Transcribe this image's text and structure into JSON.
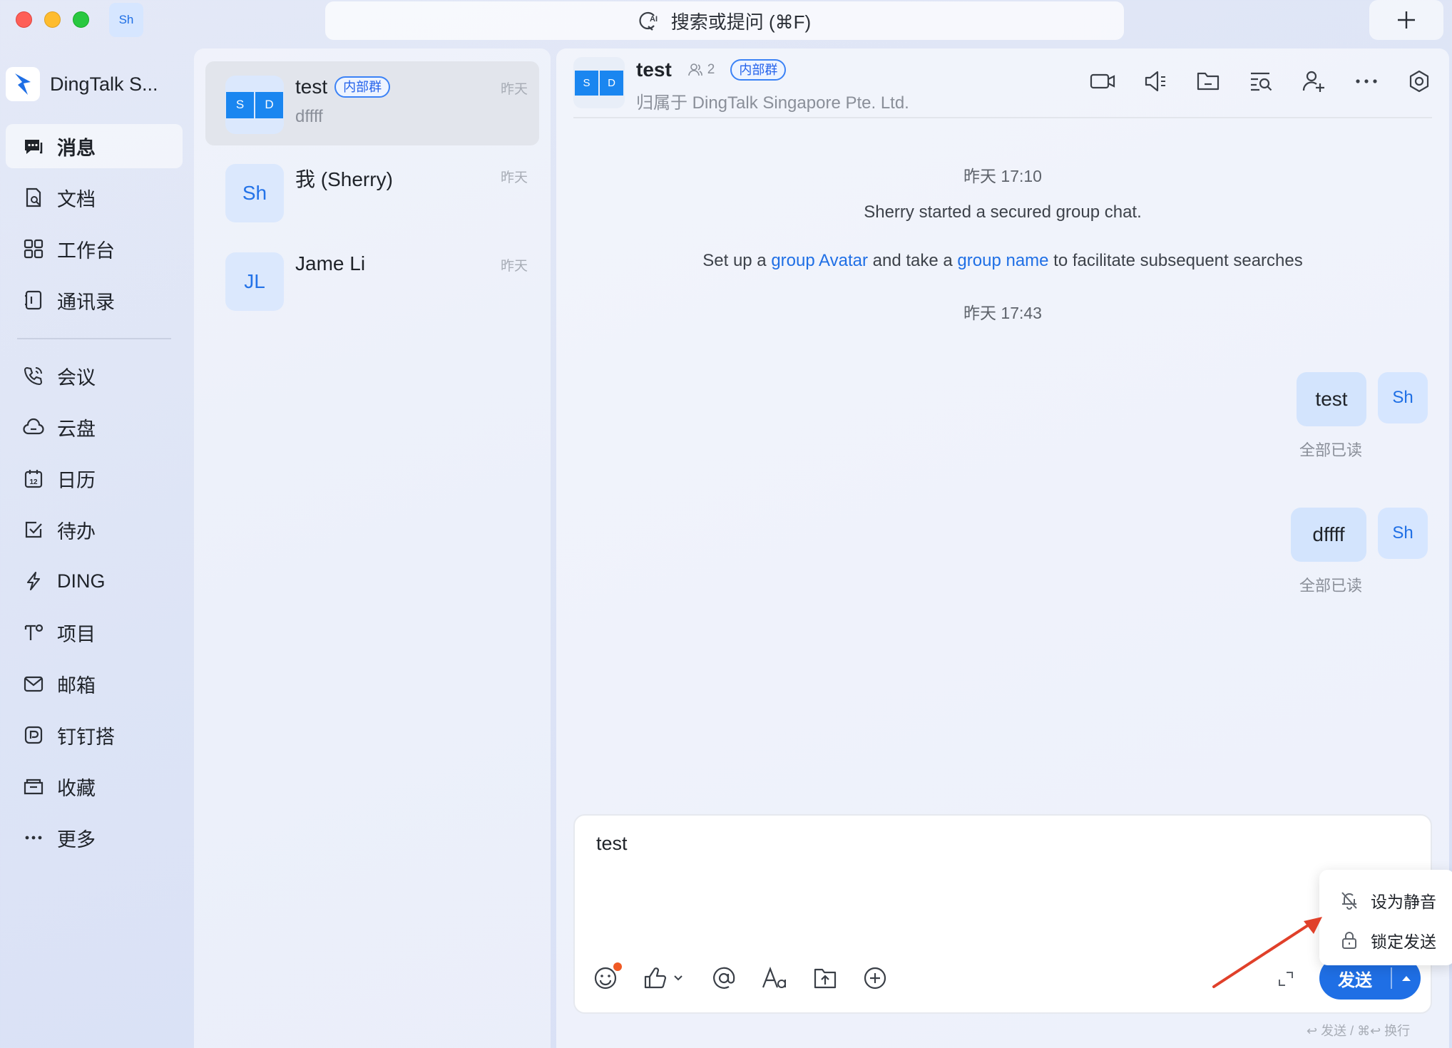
{
  "titlebar": {
    "avatar": "Sh",
    "search_placeholder": "搜索或提问 (⌘F)"
  },
  "sidebar": {
    "org_name": "DingTalk S...",
    "items": [
      {
        "label": "消息",
        "icon": "message-icon",
        "active": true
      },
      {
        "label": "文档",
        "icon": "document-icon"
      },
      {
        "label": "工作台",
        "icon": "workbench-grid-icon"
      },
      {
        "label": "通讯录",
        "icon": "contacts-icon"
      },
      {
        "label": "会议",
        "icon": "phone-icon"
      },
      {
        "label": "云盘",
        "icon": "cloud-icon"
      },
      {
        "label": "日历",
        "icon": "calendar-icon",
        "calendar_day": "12"
      },
      {
        "label": "待办",
        "icon": "todo-check-icon"
      },
      {
        "label": "DING",
        "icon": "lightning-icon"
      },
      {
        "label": "项目",
        "icon": "project-icon"
      },
      {
        "label": "邮箱",
        "icon": "mail-icon"
      },
      {
        "label": "钉钉搭",
        "icon": "builder-icon"
      },
      {
        "label": "收藏",
        "icon": "favorites-folder-icon"
      },
      {
        "label": "更多",
        "icon": "more-dots-icon"
      }
    ]
  },
  "conversations": [
    {
      "title": "test",
      "tag": "内部群",
      "preview": "dffff",
      "time": "昨天",
      "avatar_tiles": [
        "S",
        "D"
      ],
      "selected": true
    },
    {
      "title": "我 (Sherry)",
      "preview": "",
      "time": "昨天",
      "avatar": "Sh"
    },
    {
      "title": "Jame Li",
      "preview": "",
      "time": "昨天",
      "avatar": "JL"
    }
  ],
  "chat": {
    "avatar_tiles": [
      "S",
      "D"
    ],
    "name": "test",
    "member_count": "2",
    "tag": "内部群",
    "subtitle": "归属于 DingTalk Singapore Pte. Ltd.",
    "header_icons": [
      "video-call-icon",
      "announcement-icon",
      "folder-icon",
      "search-history-icon",
      "add-member-icon",
      "more-icon",
      "settings-icon"
    ],
    "system": {
      "time1": "昨天 17:10",
      "started": "Sherry started a secured group chat.",
      "setup_prefix": "Set up a ",
      "link_avatar": "group Avatar",
      "setup_middle": " and take a ",
      "link_name": "group name",
      "setup_suffix": " to facilitate subsequent searches",
      "time2": "昨天 17:43"
    },
    "messages": [
      {
        "text": "test",
        "avatar": "Sh",
        "status": "全部已读"
      },
      {
        "text": "dffff",
        "avatar": "Sh",
        "status": "全部已读"
      }
    ]
  },
  "composer": {
    "text": "test",
    "toolbar": [
      "emoji-icon",
      "thumbs-up-icon",
      "mention-icon",
      "font-format-icon",
      "upload-file-icon",
      "add-circle-icon"
    ],
    "send_label": "发送",
    "hint": "↩ 发送 / ⌘↩ 换行",
    "popup": {
      "mute_label": "设为静音",
      "lock_label": "锁定发送"
    }
  },
  "colors": {
    "accent": "#1f6fe5",
    "bubble": "#d3e4fd",
    "annotation_arrow": "#e0402a"
  }
}
